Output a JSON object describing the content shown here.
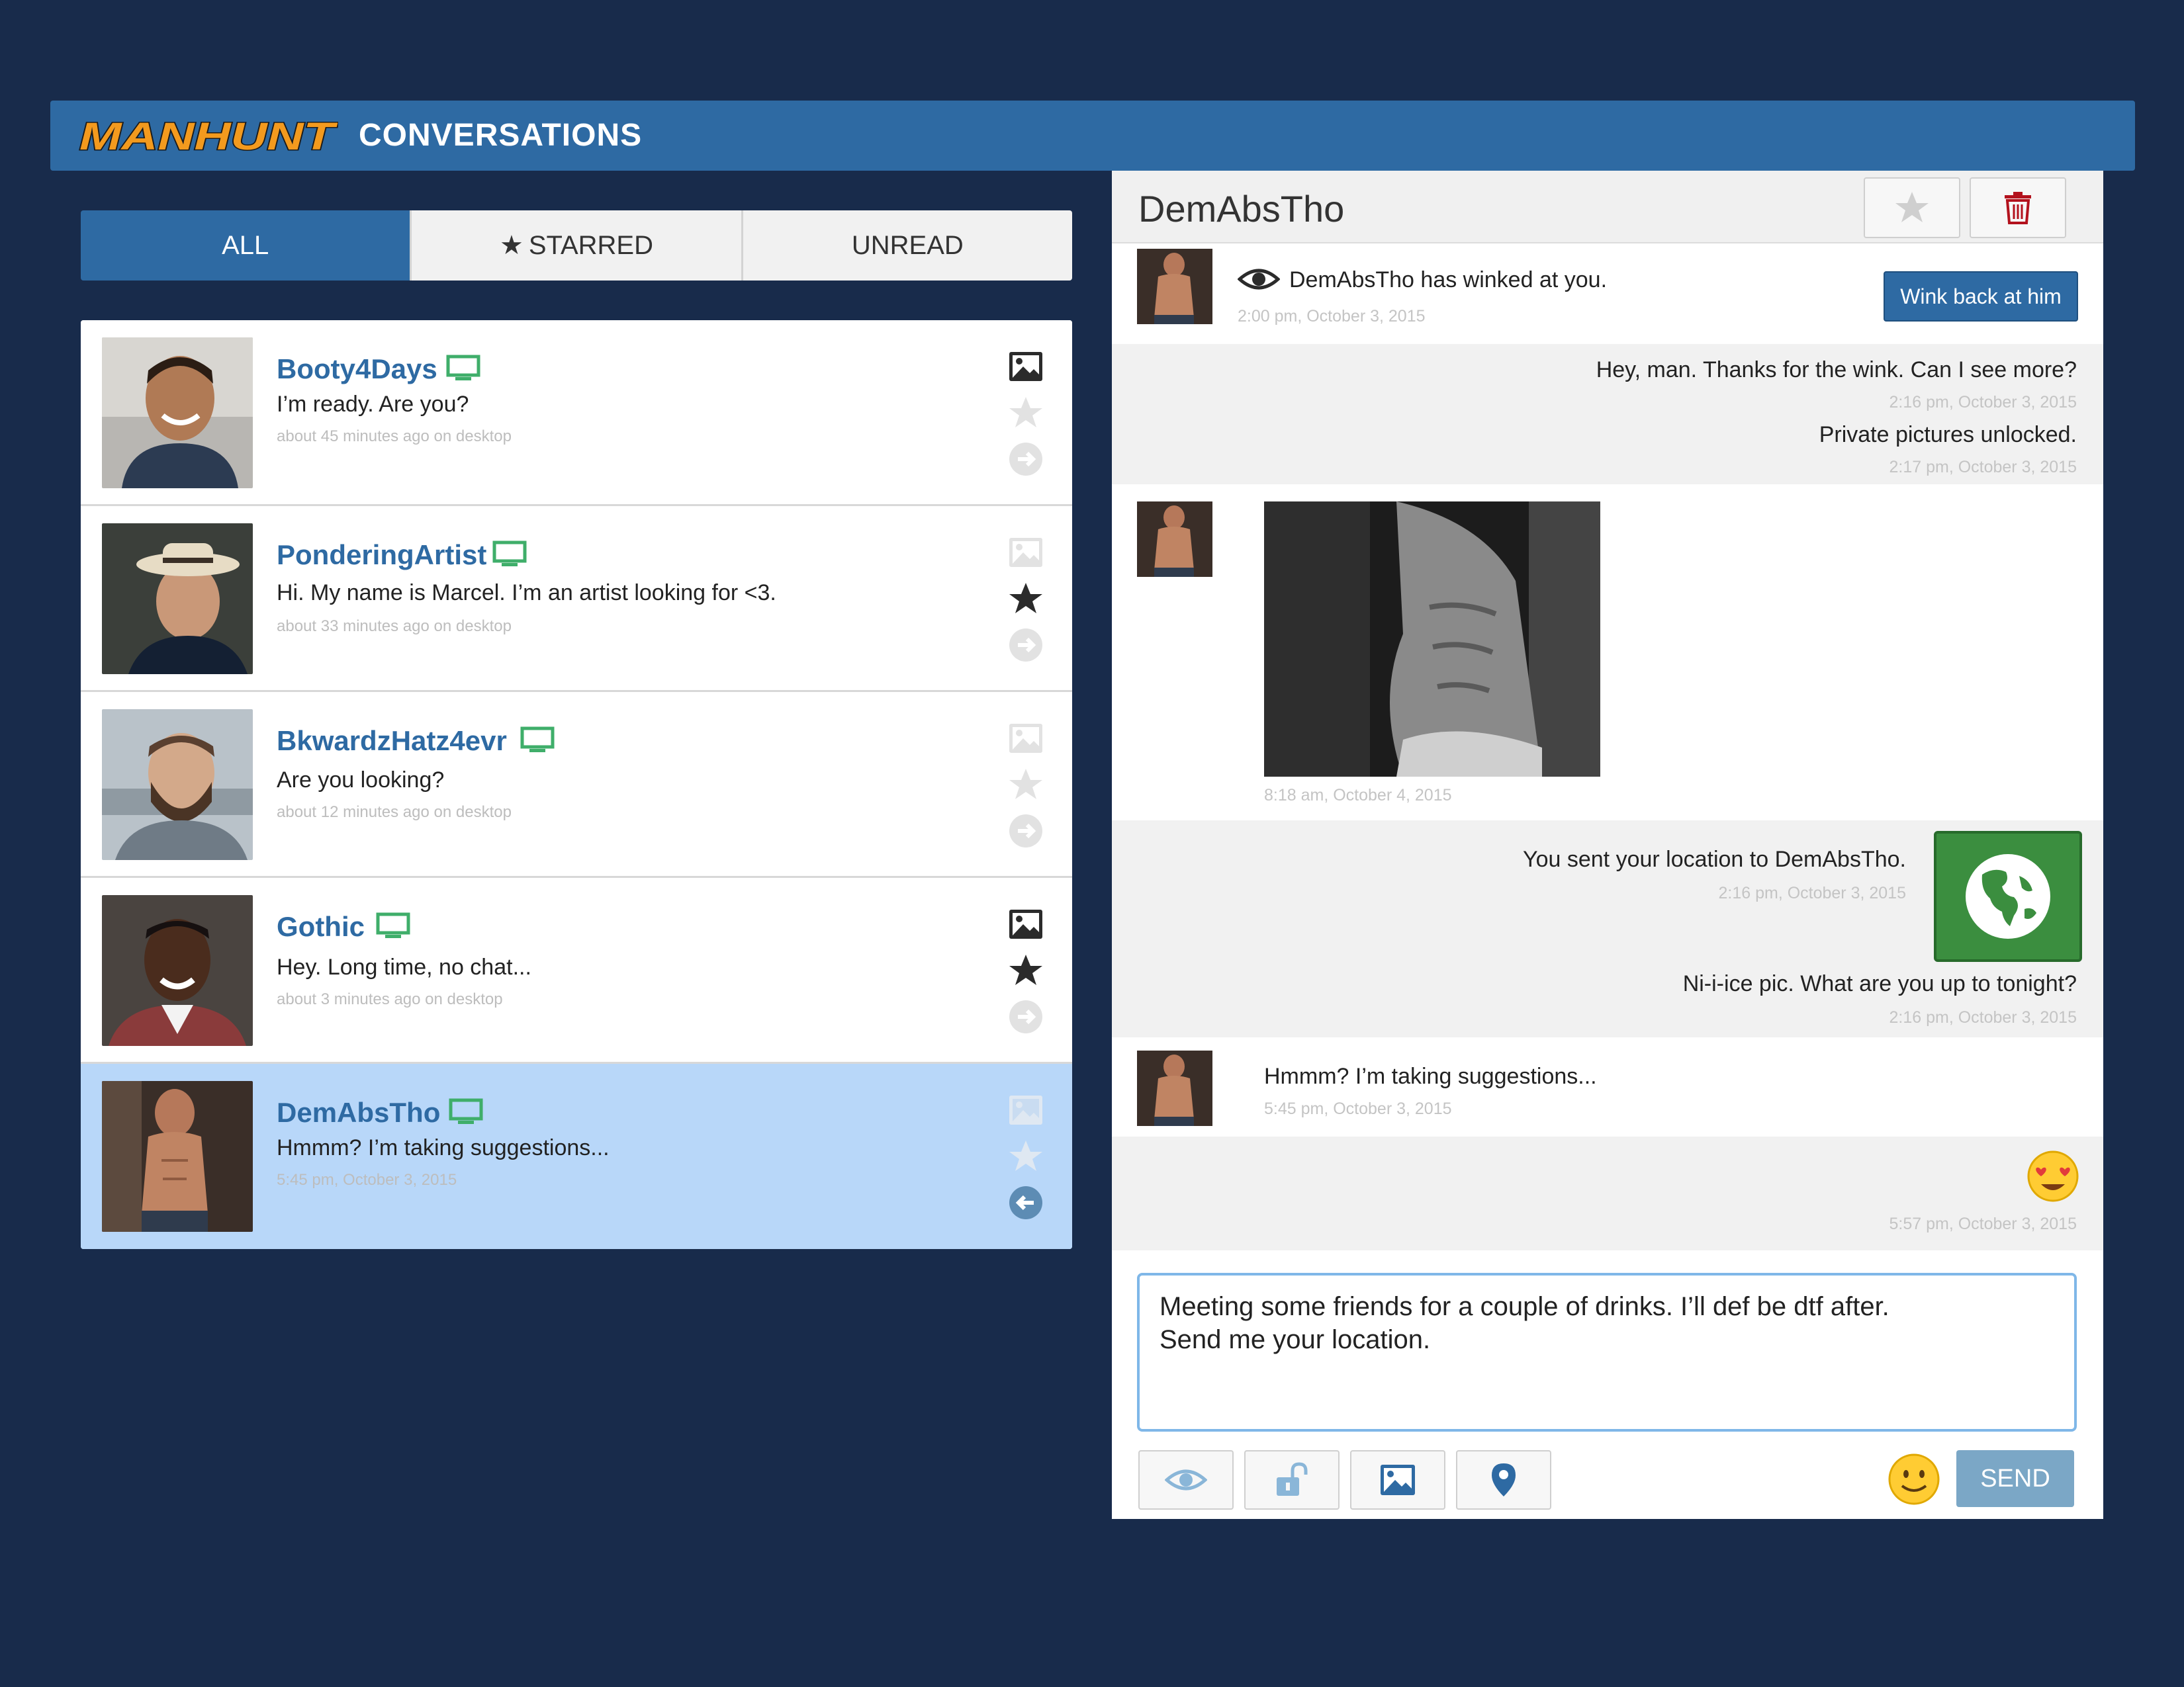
{
  "brand": {
    "logo_text": "MANHUNT",
    "section_title": "CONVERSATIONS"
  },
  "tabs": [
    {
      "label": "ALL",
      "active": true
    },
    {
      "label": "STARRED",
      "icon": "star-icon",
      "active": false
    },
    {
      "label": "UNREAD",
      "active": false
    }
  ],
  "conversations": [
    {
      "name": "Booty4Days",
      "message": "I’m ready. Are you?",
      "time": "about 45 minutes ago on desktop",
      "has_photo": true,
      "starred": false,
      "selected": false
    },
    {
      "name": "PonderingArtist",
      "message": "Hi. My name is Marcel. I’m an artist looking for <3.",
      "time": "about 33 minutes ago on desktop",
      "has_photo": false,
      "starred": true,
      "selected": false
    },
    {
      "name": "BkwardzHatz4evr",
      "message": "Are you looking?",
      "time": "about 12 minutes ago on desktop",
      "has_photo": false,
      "starred": false,
      "selected": false
    },
    {
      "name": "Gothic",
      "message": "Hey. Long time, no chat...",
      "time": "about 3 minutes ago on desktop",
      "has_photo": true,
      "starred": true,
      "selected": false
    },
    {
      "name": "DemAbsTho",
      "message": "Hmmm? I’m taking suggestions...",
      "time": "5:45 pm, October 3, 2015",
      "has_photo": false,
      "starred": false,
      "selected": true
    }
  ],
  "chat": {
    "contact_name": "DemAbsTho",
    "wink": {
      "text": "DemAbsTho has winked at you.",
      "time": "2:00 pm, October 3, 2015",
      "button_label": "Wink back at him"
    },
    "out_1": {
      "text": "Hey, man. Thanks for the wink. Can I see more?",
      "time": "2:16 pm, October 3, 2015"
    },
    "out_2": {
      "text": "Private pictures unlocked.",
      "time": "2:17 pm, October 3, 2015"
    },
    "photo_msg": {
      "time": "8:18 am, October 4, 2015"
    },
    "out_3": {
      "text": "You sent your location to DemAbsTho.",
      "time": "2:16 pm, October 3, 2015"
    },
    "out_4": {
      "text": "Ni-i-ice pic. What are you up to tonight?",
      "time": "2:16 pm, October 3, 2015"
    },
    "in_2": {
      "text": "Hmmm? I’m taking suggestions...",
      "time": "5:45 pm, October 3, 2015"
    },
    "out_5": {
      "emoji": "heart-eyes-emoji",
      "time": "5:57 pm, October 3, 2015"
    },
    "compose": {
      "value": "Meeting some friends for a couple of drinks. I’ll def be dtf after.\nSend me your location."
    },
    "send_label": "SEND"
  },
  "colors": {
    "background": "#182b4b",
    "accent": "#2e6aa3",
    "online_green": "#3fae6a",
    "selected_row": "#b8d7f9"
  }
}
